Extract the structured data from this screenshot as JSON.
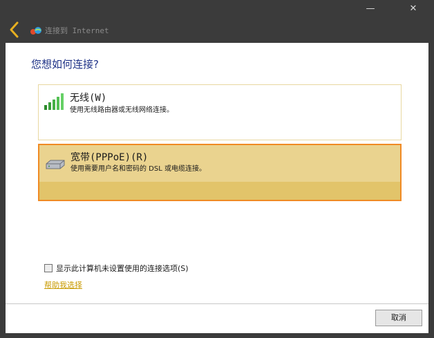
{
  "window": {
    "title": "连接到 Internet",
    "minimize_glyph": "—",
    "close_glyph": "✕"
  },
  "heading": "您想如何连接?",
  "options": [
    {
      "title": "无线(W)",
      "description": "使用无线路由器或无线网络连接。",
      "icon": "wireless-signal-icon",
      "selected": false
    },
    {
      "title": "宽带(PPPoE)(R)",
      "description": "使用需要用户名和密码的 DSL 或电缆连接。",
      "icon": "broadband-modem-icon",
      "selected": true
    }
  ],
  "show_unconfigured": {
    "label": "显示此计算机未设置使用的连接选项(S)",
    "checked": false
  },
  "help_link": "帮助我选择",
  "footer": {
    "cancel_label": "取消"
  },
  "colors": {
    "accent": "#f08a24",
    "heading": "#1e3287",
    "link": "#c89a00",
    "titlebar": "#3b3b3b"
  }
}
